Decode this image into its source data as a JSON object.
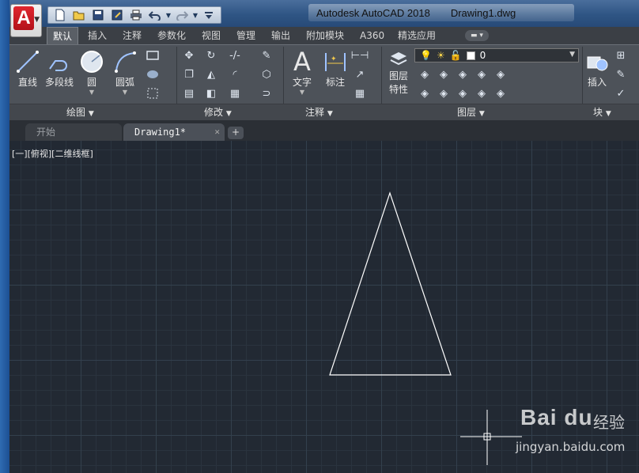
{
  "window": {
    "app_title": "Autodesk AutoCAD 2018",
    "file_title": "Drawing1.dwg"
  },
  "app_button": {
    "letter": "A"
  },
  "quick_access": [
    "new-icon",
    "open-icon",
    "save-icon",
    "save-as-icon",
    "print-icon",
    "undo-icon",
    "redo-icon",
    "customize-icon"
  ],
  "ribbon_tabs": [
    {
      "label": "默认",
      "active": true
    },
    {
      "label": "插入"
    },
    {
      "label": "注释"
    },
    {
      "label": "参数化"
    },
    {
      "label": "视图"
    },
    {
      "label": "管理"
    },
    {
      "label": "输出"
    },
    {
      "label": "附加模块"
    },
    {
      "label": "A360"
    },
    {
      "label": "精选应用"
    }
  ],
  "panels": {
    "draw": {
      "title": "绘图",
      "tools": [
        "直线",
        "多段线",
        "圆",
        "圆弧"
      ]
    },
    "modify": {
      "title": "修改"
    },
    "annotation": {
      "title": "注释",
      "tools": [
        "文字",
        "标注"
      ]
    },
    "layers": {
      "title": "图层",
      "properties_label_1": "图层",
      "properties_label_2": "特性",
      "current_layer": "0"
    },
    "block": {
      "title": "块",
      "insert_label": "插入"
    }
  },
  "document_tabs": {
    "start": "开始",
    "drawing": "Drawing1*",
    "close": "✕",
    "add": "+"
  },
  "viewport": {
    "label": "[一][俯视][二维线框]"
  },
  "watermark": {
    "logo": "Bai du",
    "cn": "经验",
    "url": "jingyan.baidu.com"
  },
  "colors": {
    "canvas_bg": "#222933",
    "ribbon_bg": "#4d5259",
    "accent_red": "#c8161e",
    "drawing_line": "#ffffff"
  }
}
